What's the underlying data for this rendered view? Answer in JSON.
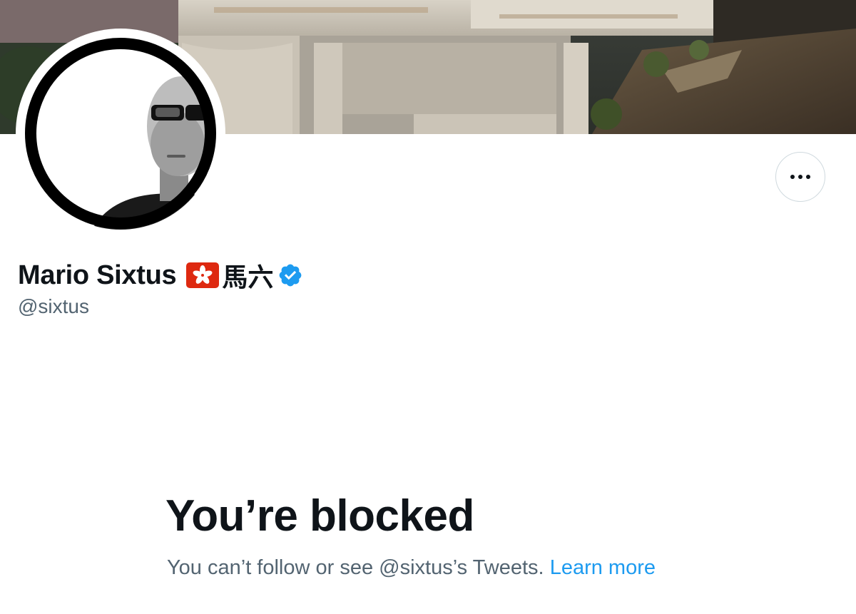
{
  "profile": {
    "display_name": "Mario Sixtus",
    "cjk_name": "馬六",
    "handle": "@sixtus",
    "flag_icon": "hong-kong-flag-icon",
    "verified_icon": "verified-badge-icon"
  },
  "actions": {
    "more_icon": "more-horizontal-icon"
  },
  "blocked": {
    "title": "You’re blocked",
    "message": "You can’t follow or see @sixtus’s Tweets.",
    "link_label": "Learn more"
  },
  "colors": {
    "text_primary": "#0f1419",
    "text_secondary": "#536471",
    "link": "#1d9bf0",
    "verified": "#1d9bf0",
    "flag_red": "#de2910",
    "button_border": "#cfd9de"
  }
}
